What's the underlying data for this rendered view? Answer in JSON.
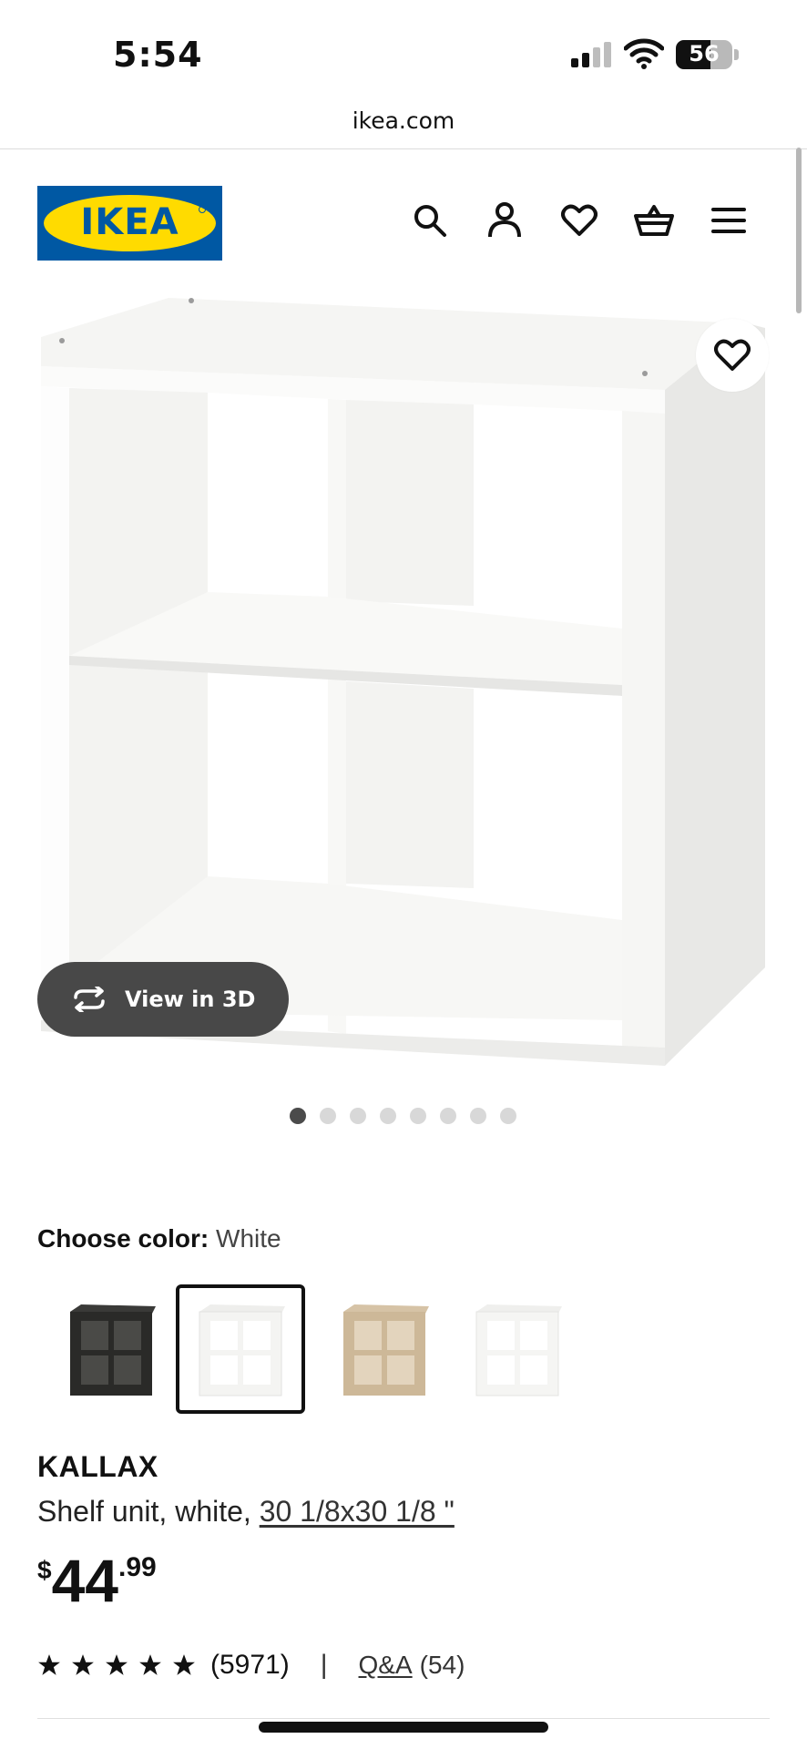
{
  "status_bar": {
    "time": "5:54",
    "battery": "56"
  },
  "url_bar": {
    "domain": "ikea.com"
  },
  "header": {
    "logo_text": "IKEA",
    "icons": [
      "search-icon",
      "account-icon",
      "favorites-icon",
      "cart-icon",
      "menu-icon"
    ],
    "brand_colors": {
      "blue": "#0058a3",
      "yellow": "#ffdb00"
    }
  },
  "gallery": {
    "view3d_label": "View in 3D",
    "image_count": 8,
    "active_index": 0
  },
  "color_chooser": {
    "label": "Choose color:",
    "selected": "White",
    "options": [
      "black-brown",
      "white",
      "white-stained-oak",
      "white-alt"
    ]
  },
  "product": {
    "name": "KALLAX",
    "description": "Shelf unit, white,",
    "size": "30 1/8x30 1/8 \"",
    "price": {
      "currency": "$",
      "integer": "44",
      "decimal": ".99"
    }
  },
  "rating": {
    "stars": 5,
    "count": "(5971)",
    "separator": "|",
    "qa_label": "Q&A",
    "qa_count": "(54)"
  }
}
